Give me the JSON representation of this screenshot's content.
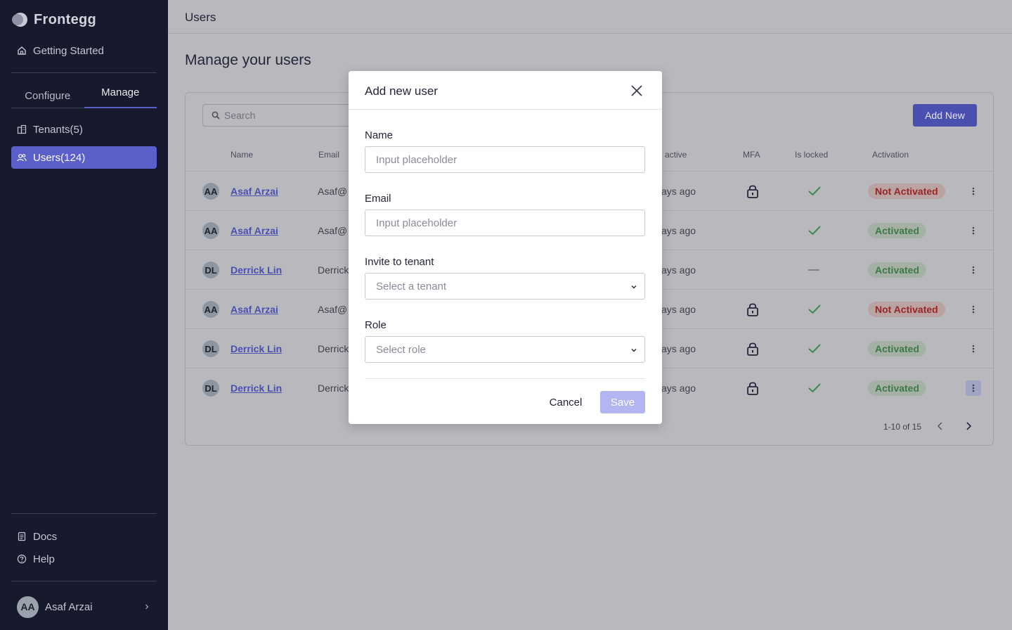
{
  "sidebar": {
    "brand": "Frontegg",
    "getting_started": "Getting Started",
    "tabs": [
      "Configure",
      "Manage"
    ],
    "active_tab": "Manage",
    "items": [
      {
        "label": "Tenants(5)",
        "icon": "building-icon",
        "active": false
      },
      {
        "label": "Users(124)",
        "icon": "users-icon",
        "active": true
      }
    ],
    "docs": "Docs",
    "help": "Help",
    "user": {
      "initials": "AA",
      "name": "Asaf Arzai"
    }
  },
  "header": {
    "title": "Users"
  },
  "main": {
    "page_title": "Manage your users",
    "search_placeholder": "Search",
    "add_new_label": "Add New",
    "columns": [
      "Name",
      "Email",
      "active",
      "MFA",
      "Is locked",
      "Activation"
    ],
    "rows": [
      {
        "initials": "AA",
        "name": "Asaf Arzai",
        "email": "Asaf@",
        "last_active": "ays ago",
        "mfa": "lock",
        "locked": "check",
        "activation": "Not Activated",
        "status": "not"
      },
      {
        "initials": "AA",
        "name": "Asaf Arzai",
        "email": "Asaf@",
        "last_active": "ays ago",
        "mfa": "",
        "locked": "check",
        "activation": "Activated",
        "status": "act"
      },
      {
        "initials": "DL",
        "name": "Derrick Lin",
        "email": "Derrick",
        "last_active": "ays ago",
        "mfa": "",
        "locked": "dash",
        "activation": "Activated",
        "status": "act"
      },
      {
        "initials": "AA",
        "name": "Asaf Arzai",
        "email": "Asaf@",
        "last_active": "ays ago",
        "mfa": "lock",
        "locked": "check",
        "activation": "Not Activated",
        "status": "not"
      },
      {
        "initials": "DL",
        "name": "Derrick Lin",
        "email": "Derrick",
        "last_active": "ays ago",
        "mfa": "lock",
        "locked": "check",
        "activation": "Activated",
        "status": "act"
      },
      {
        "initials": "DL",
        "name": "Derrick Lin",
        "email": "Derrick",
        "last_active": "ays ago",
        "mfa": "lock",
        "locked": "check",
        "activation": "Activated",
        "status": "act"
      }
    ],
    "pagination": "1-10 of 15"
  },
  "modal": {
    "title": "Add new user",
    "name_label": "Name",
    "name_placeholder": "Input placeholder",
    "email_label": "Email",
    "email_placeholder": "Input placeholder",
    "tenant_label": "Invite to tenant",
    "tenant_placeholder": "Select a tenant",
    "role_label": "Role",
    "role_placeholder": "Select role",
    "cancel_label": "Cancel",
    "save_label": "Save"
  },
  "colors": {
    "accent": "#5a5fc9",
    "sidebar_bg": "#171a2c",
    "not_activated": "#9b2424",
    "activated": "#3d7a45"
  }
}
